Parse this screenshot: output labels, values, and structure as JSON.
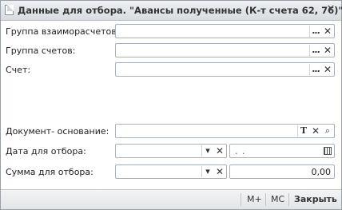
{
  "window": {
    "title": "Данные для отбора. \"Авансы полученные (К-т счета 62, 76)\"",
    "close_glyph": "✕"
  },
  "form": {
    "group_settlements": {
      "label": "Группа взаиморасчетов:",
      "value": ""
    },
    "group_accounts": {
      "label": "Группа счетов:",
      "value": ""
    },
    "account": {
      "label": "Счет:",
      "value": ""
    },
    "base_document": {
      "label": "Документ- основание:",
      "value": ""
    },
    "filter_date": {
      "label": "Дата для отбора:",
      "value": "",
      "date_value": ".  ."
    },
    "filter_amount": {
      "label": "Сумма для отбора:",
      "value": "",
      "amount_value": "0,00"
    }
  },
  "buttons": {
    "select_glyph": "...",
    "clear_glyph": "✕",
    "type_glyph": "T",
    "search_glyph": "⌕",
    "dropdown_glyph": "▾"
  },
  "footer": {
    "m_plus": "M+",
    "mc": "MC",
    "close": "Закрыть"
  }
}
